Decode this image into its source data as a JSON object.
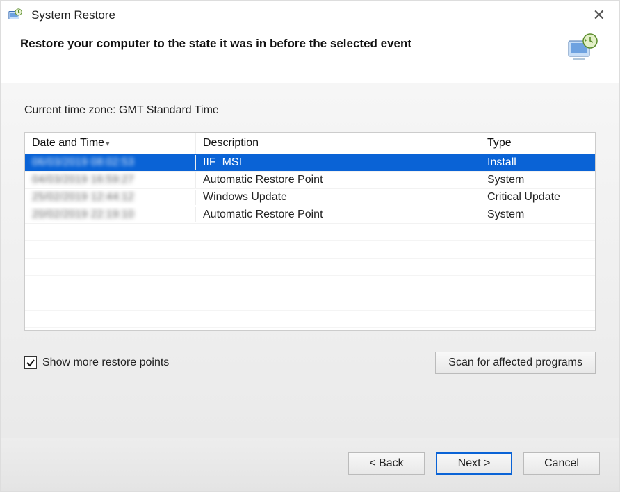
{
  "window": {
    "title": "System Restore"
  },
  "header": {
    "heading": "Restore your computer to the state it was in before the selected event"
  },
  "timezone": {
    "label": "Current time zone: GMT Standard Time"
  },
  "table": {
    "columns": {
      "date": "Date and Time",
      "description": "Description",
      "type": "Type"
    },
    "rows": [
      {
        "date": "06/03/2019 08:02:53",
        "description": "IIF_MSI",
        "type": "Install",
        "selected": true
      },
      {
        "date": "04/03/2019 16:59:27",
        "description": "Automatic Restore Point",
        "type": "System",
        "selected": false
      },
      {
        "date": "25/02/2019 12:44:12",
        "description": "Windows Update",
        "type": "Critical Update",
        "selected": false
      },
      {
        "date": "20/02/2019 22:19:10",
        "description": "Automatic Restore Point",
        "type": "System",
        "selected": false
      }
    ]
  },
  "options": {
    "show_more_label": "Show more restore points",
    "show_more_checked": true
  },
  "buttons": {
    "scan": "Scan for affected programs",
    "back": "< Back",
    "next": "Next >",
    "cancel": "Cancel"
  }
}
